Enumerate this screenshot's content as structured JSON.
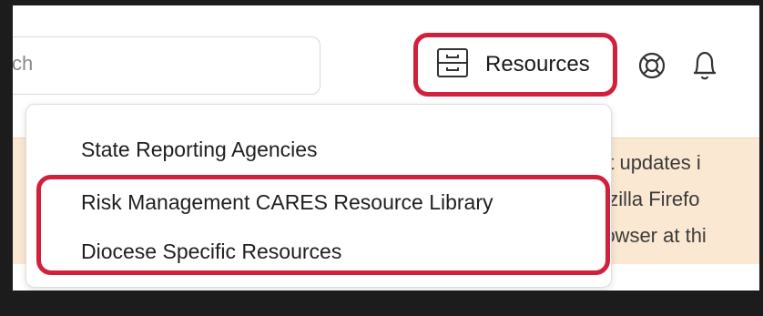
{
  "search": {
    "placeholder_fragment": "ch"
  },
  "header": {
    "resources_label": "Resources",
    "help_icon": "lifebuoy-icon",
    "notification_icon": "bell-icon",
    "resources_icon": "drawer-icon"
  },
  "menu": {
    "items": [
      {
        "label": "State Reporting Agencies"
      },
      {
        "label": "Risk Management CARES Resource Library"
      },
      {
        "label": "Diocese Specific Resources"
      }
    ]
  },
  "banner": {
    "lines": [
      "at updates i",
      "ozilla Firefo",
      "rowser at thi"
    ]
  },
  "colors": {
    "highlight": "#d21f3c",
    "banner_bg": "#fbe8d2",
    "frame_bg": "#1c1c1c"
  }
}
